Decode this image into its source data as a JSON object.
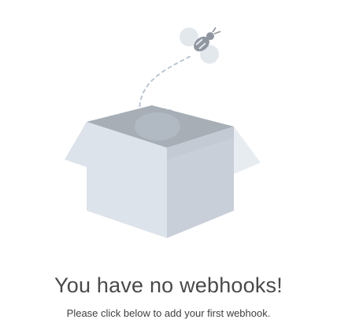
{
  "empty_state": {
    "illustration_icon": "empty-box-with-bee-icon",
    "title": "You have no webhooks!",
    "message": "Please click below to add your first webhook."
  },
  "colors": {
    "box_dark": "#a7aeb6",
    "box_mid": "#c8cfd8",
    "box_light": "#dde3ea",
    "box_lighter": "#e7ecf1",
    "bee_body": "#8f969f",
    "bee_wing": "#e3e8ed",
    "path": "#b9c6d4",
    "title_text": "#4a4a4a",
    "message_text": "#3f3f3f"
  }
}
